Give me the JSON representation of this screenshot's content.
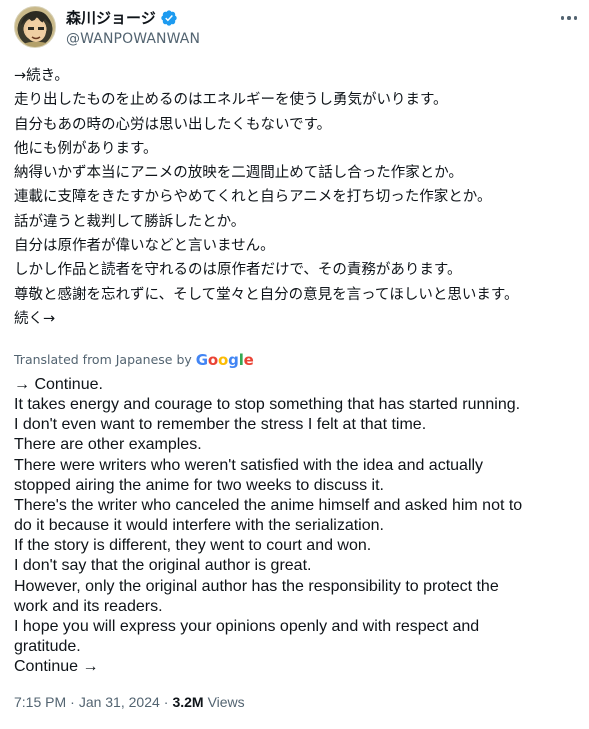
{
  "author": {
    "display_name": "森川ジョージ",
    "handle": "@WANPOWANWAN",
    "verified": true,
    "verified_color": "#1d9bf0"
  },
  "more_icon": "more-horizontal-icon",
  "post": {
    "original_lines": [
      "→続き。",
      "走り出したものを止めるのはエネルギーを使うし勇気がいります。",
      "自分もあの時の心労は思い出したくもないです。",
      "他にも例があります。",
      "納得いかず本当にアニメの放映を二週間止めて話し合った作家とか。",
      "連載に支障をきたすからやめてくれと自らアニメを打ち切った作家とか。",
      "話が違うと裁判して勝訴したとか。",
      "自分は原作者が偉いなどと言いません。",
      "しかし作品と読者を守れるのは原作者だけで、その責務があります。",
      "尊敬と感謝を忘れずに、そして堂々と自分の意見を言ってほしいと思います。",
      "続く→"
    ],
    "translated_label": "Translated from Japanese by",
    "translator_brand": "Google",
    "translation_lines": [
      "→ Continue.",
      "It takes energy and courage to stop something that has started running.",
      "I don't even want to remember the stress I felt at that time.",
      "There are other examples.",
      "There were writers who weren't satisfied with the idea and actually",
      "stopped airing the anime for two weeks to discuss it.",
      "There's the writer who canceled the anime himself and asked him not to",
      "do it because it would interfere with the serialization.",
      "If the story is different, they went to court and won.",
      "I don't say that the original author is great.",
      "However, only the original author has the responsibility to protect the",
      "work and its readers.",
      "I hope you will express your opinions openly and with respect and",
      "gratitude.",
      "Continue →"
    ]
  },
  "meta": {
    "time": "7:15 PM",
    "separator": "·",
    "date": "Jan 31, 2024",
    "view_count": "3.2M",
    "views_label": "Views"
  }
}
